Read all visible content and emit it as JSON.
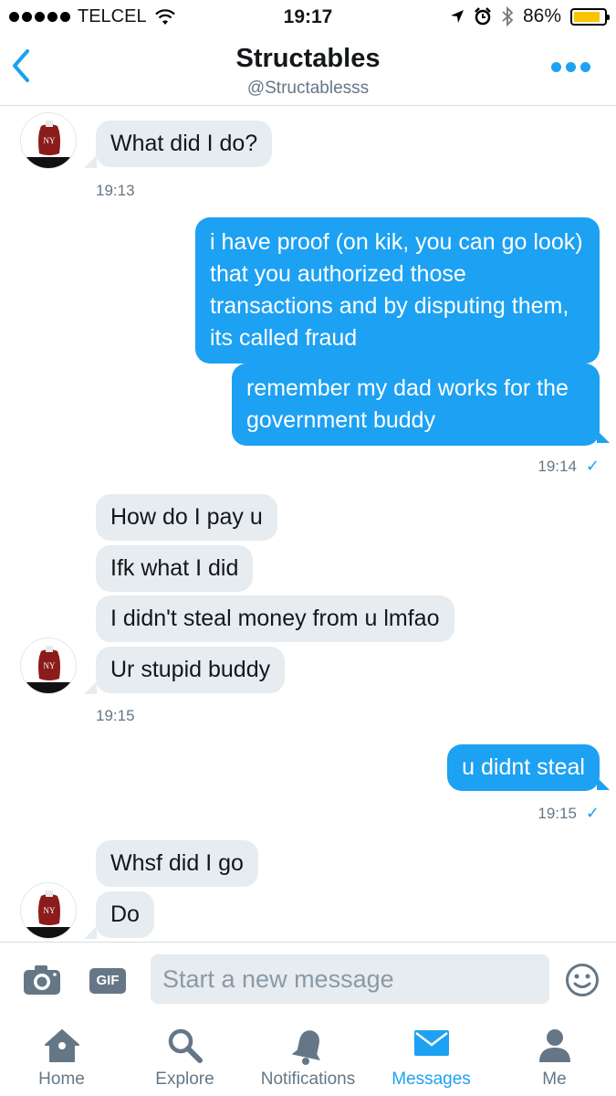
{
  "status_bar": {
    "carrier": "TELCEL",
    "time": "19:17",
    "battery_percent": "86%",
    "battery_level": 0.86
  },
  "header": {
    "title": "Structables",
    "handle": "@Structablesss"
  },
  "messages": [
    {
      "text": "What did I do?"
    },
    {
      "text": "i have proof (on kik, you can go look) that you authorized those transactions and by disputing them, its called fraud"
    },
    {
      "text": "remember my dad works for the government buddy"
    },
    {
      "text": "How do I pay u"
    },
    {
      "text": "Ifk what I did"
    },
    {
      "text": "I didn't steal money from u lmfao"
    },
    {
      "text": "Ur stupid buddy"
    },
    {
      "text": "u didnt steal"
    },
    {
      "text": "Whsf did I go"
    },
    {
      "text": "Do"
    }
  ],
  "timestamps": [
    "19:13",
    "19:14",
    "19:15",
    "19:15"
  ],
  "composer": {
    "gif_label": "GIF",
    "placeholder": "Start a new message"
  },
  "tabs": [
    {
      "label": "Home",
      "icon": "home-icon"
    },
    {
      "label": "Explore",
      "icon": "search-icon"
    },
    {
      "label": "Notifications",
      "icon": "bell-icon"
    },
    {
      "label": "Messages",
      "icon": "envelope-icon",
      "active": true
    },
    {
      "label": "Me",
      "icon": "person-icon"
    }
  ],
  "colors": {
    "accent": "#1da1f2",
    "incoming_bubble": "#e6ecf0",
    "muted_text": "#657786",
    "battery_fill": "#f7c600"
  }
}
